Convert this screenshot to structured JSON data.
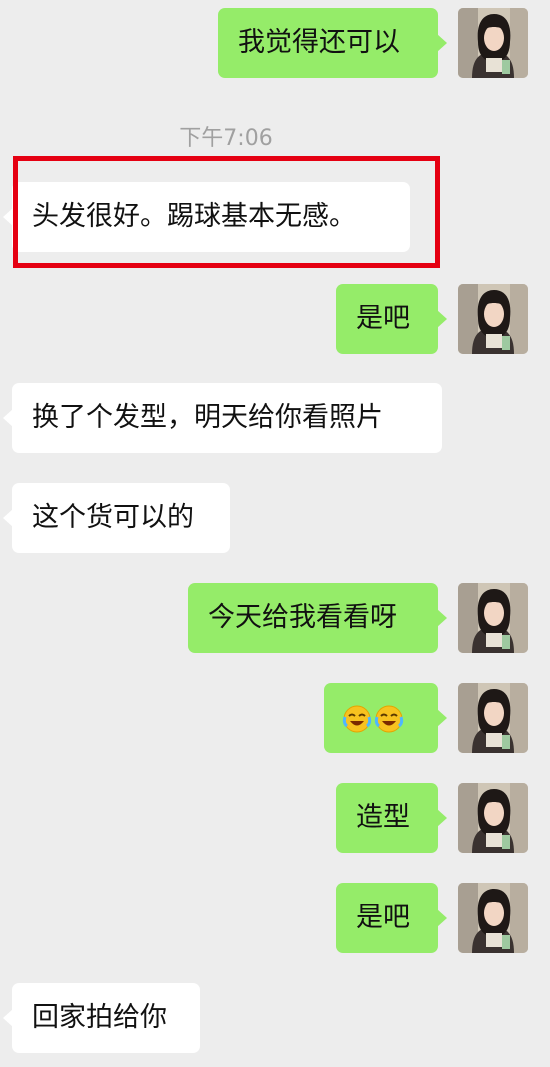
{
  "chat": {
    "timestamp": "下午7:06",
    "messages": [
      {
        "side": "out",
        "text": "我觉得还可以"
      },
      {
        "side": "in",
        "text": "头发很好。踢球基本无感。"
      },
      {
        "side": "out",
        "text": "是吧"
      },
      {
        "side": "in",
        "text": "换了个发型，明天给你看照片"
      },
      {
        "side": "in",
        "text": "这个货可以的"
      },
      {
        "side": "out",
        "text": "今天给我看看呀"
      },
      {
        "side": "out",
        "emoji": [
          "crying-laughing-emoji",
          "crying-laughing-emoji"
        ]
      },
      {
        "side": "out",
        "text": "造型"
      },
      {
        "side": "out",
        "text": "是吧"
      },
      {
        "side": "in",
        "text": "回家拍给你"
      }
    ]
  },
  "colors": {
    "background": "#ededed",
    "outgoing_bubble": "#95ec69",
    "incoming_bubble": "#ffffff",
    "highlight": "#e50012",
    "timestamp_text": "#a0a0a0"
  }
}
